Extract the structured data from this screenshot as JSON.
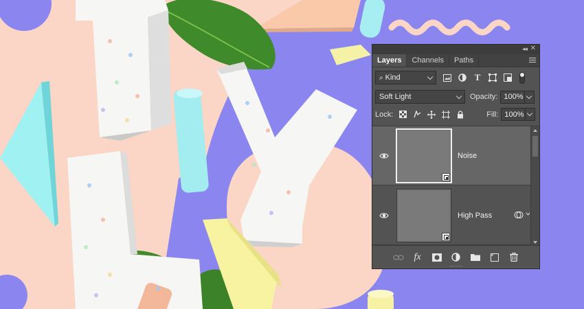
{
  "panel": {
    "tabs": [
      "Layers",
      "Channels",
      "Paths"
    ],
    "active_tab": "Layers",
    "filter": {
      "value": "Kind"
    },
    "blend_mode": {
      "value": "Soft Light"
    },
    "opacity": {
      "label": "Opacity:",
      "value": "100%"
    },
    "lock": {
      "label": "Lock:"
    },
    "fill": {
      "label": "Fill:",
      "value": "100%"
    },
    "layers": [
      {
        "name": "Noise",
        "visible": true,
        "selected": true,
        "smart_object": true
      },
      {
        "name": "High Pass",
        "visible": true,
        "selected": false,
        "smart_object": true,
        "has_smart_filters": true
      }
    ],
    "bottom_icons": [
      "link-icon",
      "fx-icon",
      "mask-icon",
      "adjustment-icon",
      "folder-icon",
      "new-layer-icon",
      "trash-icon"
    ],
    "filter_icons": [
      "image-filter-icon",
      "adjustment-filter-icon",
      "type-filter-icon",
      "shape-filter-icon",
      "smart-object-filter-icon"
    ],
    "lock_icons": [
      "lock-transparency-icon",
      "lock-image-icon",
      "lock-position-icon",
      "lock-artboard-icon",
      "lock-all-icon"
    ]
  },
  "colors": {
    "background_purple": "#8b86ef",
    "peach": "#fbd5c5",
    "cyan": "#9ff1f2",
    "yellow": "#f7f3a1",
    "panel_bg": "#535353"
  }
}
